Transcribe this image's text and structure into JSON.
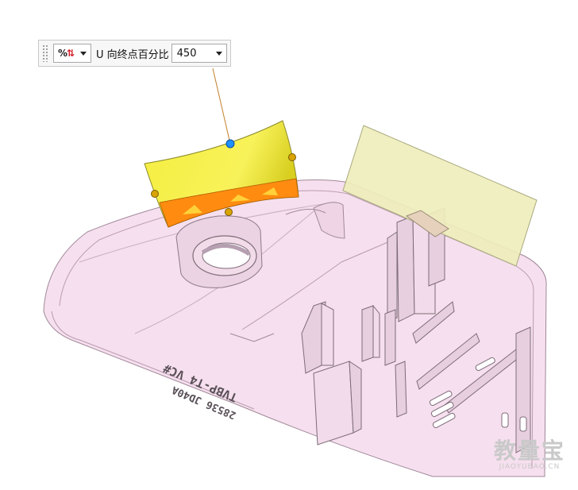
{
  "toolbar": {
    "icon": "percent-parameter-icon",
    "direction_label": "U 向终点百分比",
    "value": "450"
  },
  "part": {
    "engraving_line1": "TVBP-T4 VC#",
    "engraving_line2": "28536 JD40A"
  },
  "watermark": {
    "main": "教量宝",
    "sub": "JIAOYUBAO.CN"
  },
  "colors": {
    "part_fill": "#f5dced",
    "surface_yellow": "#f5f34a",
    "surface_orange": "#ff8800",
    "handle_blue": "#1e90ff",
    "handle_gold": "#d9a400",
    "plane_fill": "#eeeebc"
  }
}
